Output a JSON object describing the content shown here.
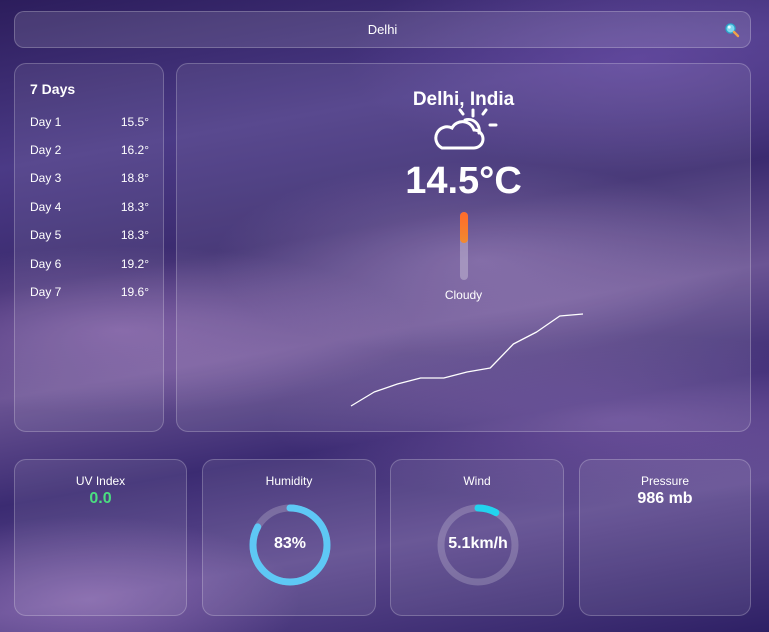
{
  "search": {
    "value": "Delhi",
    "icon": "magnifier-icon"
  },
  "forecast": {
    "title": "7 Days",
    "days": [
      {
        "name": "Day 1",
        "temp": "15.5°"
      },
      {
        "name": "Day 2",
        "temp": "16.2°"
      },
      {
        "name": "Day 3",
        "temp": "18.8°"
      },
      {
        "name": "Day 4",
        "temp": "18.3°"
      },
      {
        "name": "Day 5",
        "temp": "18.3°"
      },
      {
        "name": "Day 6",
        "temp": "19.2°"
      },
      {
        "name": "Day 7",
        "temp": "19.6°"
      }
    ]
  },
  "current": {
    "location": "Delhi, India",
    "icon": "partly-cloudy-icon",
    "temperature": "14.5°C",
    "condition": "Cloudy",
    "thermometer_level": 0.45,
    "trend_line": [
      15.5,
      16.2,
      16.6,
      16.9,
      16.9,
      17.2,
      17.4,
      18.6,
      19.2,
      20.0,
      20.1
    ]
  },
  "metrics": {
    "uv": {
      "title": "UV Index",
      "value": "0.0",
      "color": "#4ade80"
    },
    "humidity": {
      "title": "Humidity",
      "value": "83%",
      "percent": 83,
      "color": "#5ec8f5"
    },
    "wind": {
      "title": "Wind",
      "value": "5.1km/h",
      "percent": 8,
      "color": "#22d3ee"
    },
    "pressure": {
      "title": "Pressure",
      "value": "986 mb"
    }
  }
}
